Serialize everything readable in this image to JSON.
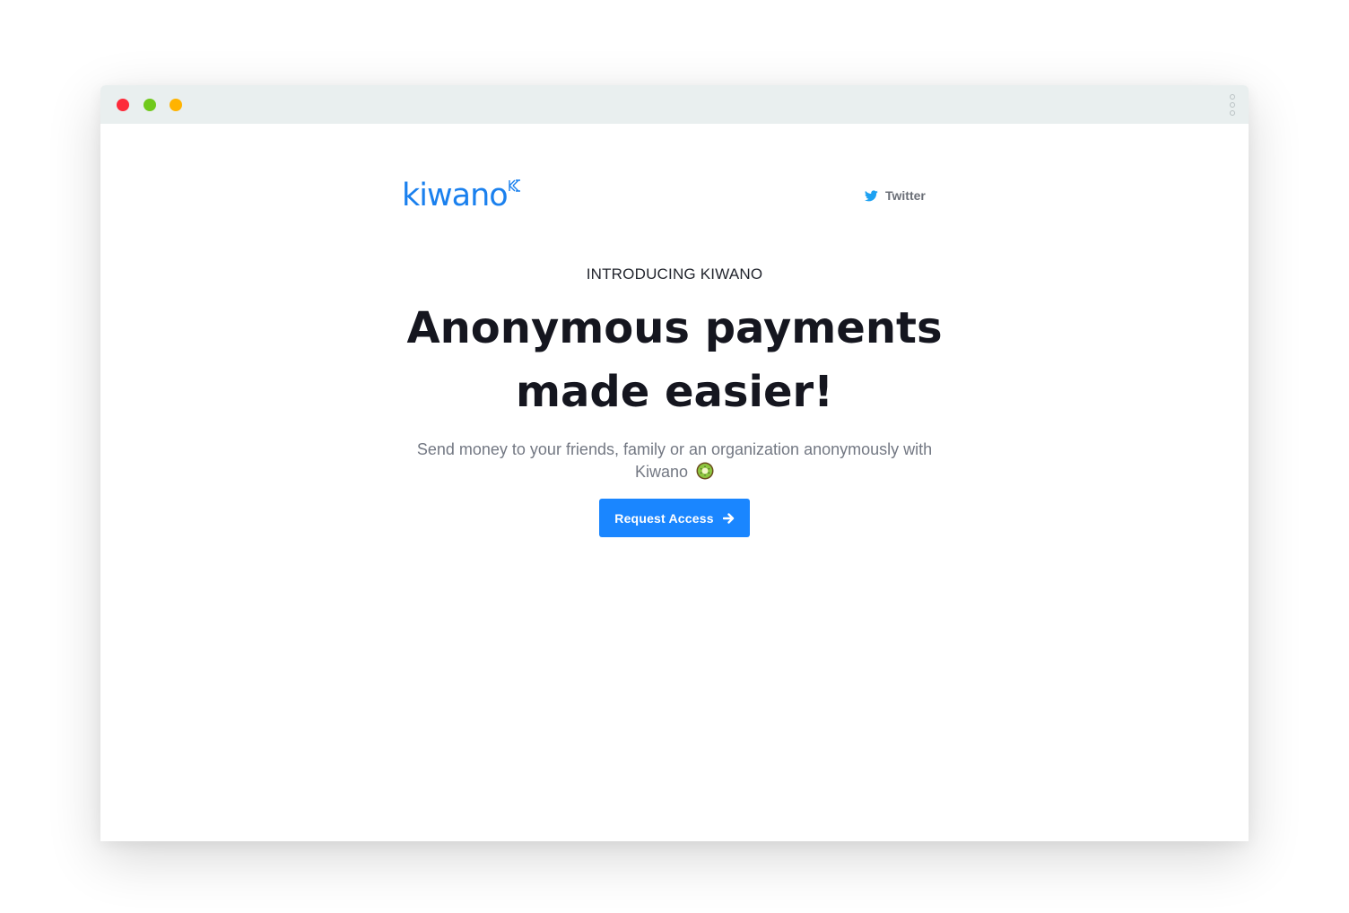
{
  "window": {
    "controls": [
      "close",
      "minimize",
      "zoom"
    ],
    "menu_icon": "kebab-menu-icon"
  },
  "brand": {
    "name": "kiwano",
    "color": "#1a80ee"
  },
  "nav": {
    "twitter_label": "Twitter",
    "twitter_icon": "twitter-icon"
  },
  "hero": {
    "eyebrow": "INTRODUCING KIWANO",
    "headline_line1": "Anonymous payments",
    "headline_line2": "made easier!",
    "subtitle": "Send money to your friends, family or an organization anonymously with Kiwano",
    "subtitle_icon": "kiwi-fruit-icon"
  },
  "cta": {
    "label": "Request Access",
    "icon": "arrow-right-icon",
    "color": "#1a86ff"
  }
}
